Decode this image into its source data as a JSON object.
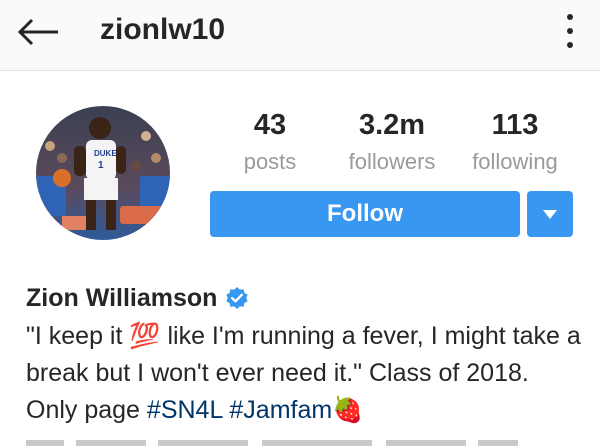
{
  "header": {
    "username": "zionlw10",
    "back_icon": "arrow-left-icon",
    "menu_icon": "more-vertical-icon"
  },
  "profile": {
    "avatar_alt": "profile photo",
    "stats": [
      {
        "value": "43",
        "label": "posts"
      },
      {
        "value": "3.2m",
        "label": "followers"
      },
      {
        "value": "113",
        "label": "following"
      }
    ],
    "follow_label": "Follow",
    "dropdown_icon": "caret-down-icon",
    "full_name": "Zion Williamson",
    "verified_icon": "verified-badge-icon",
    "bio": {
      "part1": "\"I keep it ",
      "emoji_100": "💯",
      "part2": " like I'm running a fever, I might take a break but I won't ever need it.\" Class of 2018. Only page ",
      "hashtag1": "#SN4L",
      "space": " ",
      "hashtag2": "#Jamfam",
      "emoji_strawberry": "🍓"
    }
  },
  "colors": {
    "accent": "#3897f0",
    "hashtag": "#003569",
    "muted": "#9a9a9a",
    "text": "#262626",
    "header_bg": "#fafafa"
  }
}
